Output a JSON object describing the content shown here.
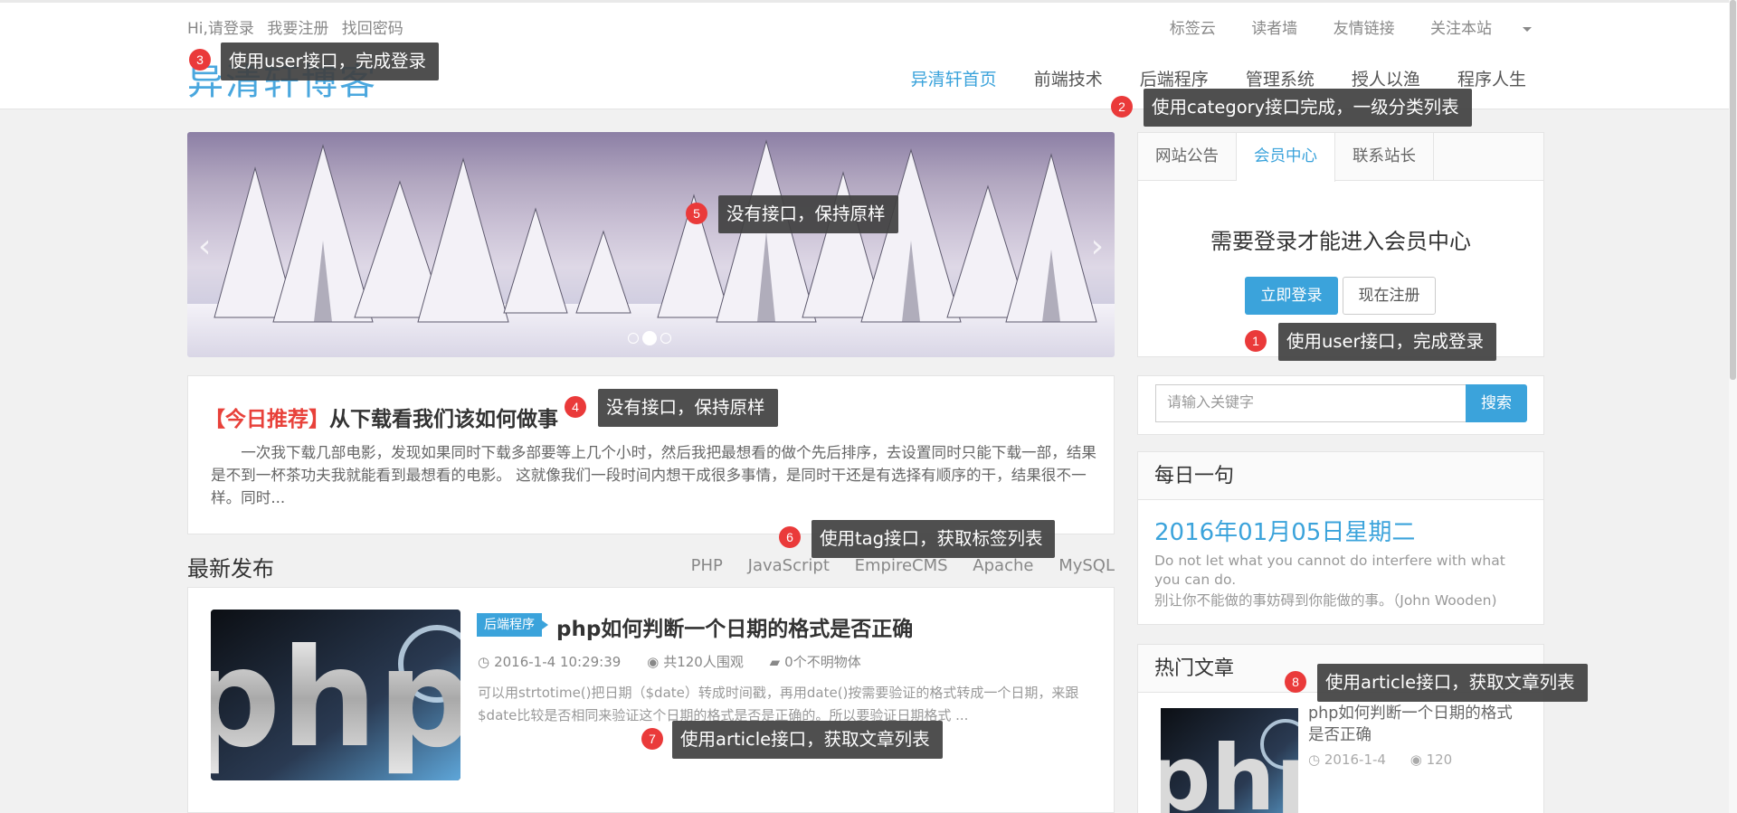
{
  "topbar": {
    "links_left": [
      "Hi,请登录",
      "我要注册",
      "找回密码"
    ],
    "links_right": [
      "标签云",
      "读者墙",
      "友情链接",
      "关注本站"
    ]
  },
  "logo_text": "异清轩博客",
  "nav": [
    "异清轩首页",
    "前端技术",
    "后端程序",
    "管理系统",
    "授人以渔",
    "程序人生"
  ],
  "recommend": {
    "tag": "【今日推荐】",
    "title": "从下载看我们该如何做事",
    "body": "一次我下载几部电影，发现如果同时下载多部要等上几个小时，然后我把最想看的做个先后排序，去设置同时只能下载一部，结果是不到一杯茶功夫我就能看到最想看的电影。 这就像我们一段时间内想干成很多事情，是同时干还是有选择有顺序的干，结果很不一样。同时..."
  },
  "latest": {
    "title": "最新发布",
    "tags": [
      "PHP",
      "JavaScript",
      "EmpireCMS",
      "Apache",
      "MySQL"
    ]
  },
  "article": {
    "category": "后端程序",
    "title": "php如何判断一个日期的格式是否正确",
    "date": "2016-1-4 10:29:39",
    "views": "共120人围观",
    "comments": "0个不明物体",
    "excerpt": "可以用strtotime()把日期（$date）转成时间戳，再用date()按需要验证的格式转成一个日期，来跟$date比较是否相同来验证这个日期的格式是否是正确的。所以要验证日期格式 ..."
  },
  "member": {
    "tabs": [
      "网站公告",
      "会员中心",
      "联系站长"
    ],
    "message": "需要登录才能进入会员中心",
    "login_button": "立即登录",
    "register_button": "现在注册"
  },
  "search": {
    "placeholder": "请输入关键字",
    "button": "搜索"
  },
  "daily": {
    "title": "每日一句",
    "date": "2016年01月05日星期二",
    "quote_en": "Do not let what you cannot do interfere with what you can do.",
    "quote_zh": "别让你不能做的事妨碍到你能做的事。（John Wooden)"
  },
  "hot": {
    "title": "热门文章",
    "article_title": "php如何判断一个日期的格式是否正确",
    "date": "2016-1-4",
    "views": "120"
  },
  "annotations": [
    {
      "num": "1",
      "text": "使用user接口，完成登录"
    },
    {
      "num": "2",
      "text": "使用category接口完成，一级分类列表"
    },
    {
      "num": "3",
      "text": "使用user接口，完成登录"
    },
    {
      "num": "4",
      "text": "没有接口，保持原样"
    },
    {
      "num": "5",
      "text": "没有接口，保持原样"
    },
    {
      "num": "6",
      "text": "使用tag接口，获取标签列表"
    },
    {
      "num": "7",
      "text": "使用article接口，获取文章列表"
    },
    {
      "num": "8",
      "text": "使用article接口，获取文章列表"
    }
  ],
  "colors": {
    "accent": "#3ba3db",
    "recommend_tag": "#e8413a",
    "annotation_bg": "#404040",
    "annotation_badge": "#ea3a3a"
  }
}
